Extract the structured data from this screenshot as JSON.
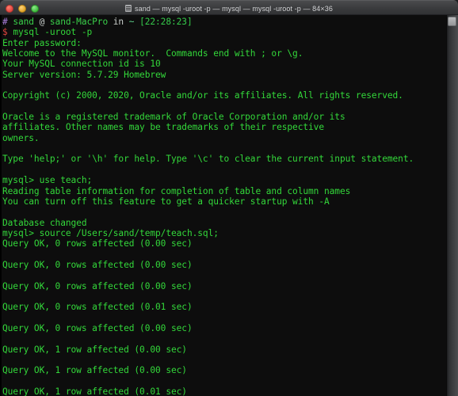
{
  "window": {
    "title": "sand — mysql -uroot -p — mysql — mysql -uroot -p — 84×36",
    "icon": "terminal-icon",
    "traffic_lights": {
      "close_label": "Close",
      "minimize_label": "Minimize",
      "maximize_label": "Maximize",
      "close_color": "#e0443e",
      "minimize_color": "#dea123",
      "maximize_color": "#3cb93a"
    },
    "size_label": "84×36",
    "columns": 84,
    "rows": 36
  },
  "theme": {
    "background": "#0d0d0d",
    "foreground": "#33d83a",
    "prompt_hash": "#a87ddb",
    "prompt_dollar": "#e0443e",
    "accent_white": "#c9cfcc",
    "titlebar_background": "#3a3b3d",
    "titlebar_text": "#d2d3d5"
  },
  "prompt": {
    "hash": "#",
    "user": "sand",
    "at": "@",
    "host": "sand-MacPro",
    "in": "in",
    "path": "~",
    "timestamp": "[22:28:23]",
    "dollar": "$",
    "command": "mysql -uroot -p"
  },
  "scrollbar": {
    "name": "vertical-scrollbar",
    "thumb_position_percent": 1
  },
  "terminal_lines": [
    {
      "type": "prompt_header"
    },
    {
      "type": "prompt_command"
    },
    {
      "type": "text",
      "text": "Enter password:"
    },
    {
      "type": "text",
      "text": "Welcome to the MySQL monitor.  Commands end with ; or \\g."
    },
    {
      "type": "text",
      "text": "Your MySQL connection id is 10"
    },
    {
      "type": "text",
      "text": "Server version: 5.7.29 Homebrew"
    },
    {
      "type": "blank",
      "text": ""
    },
    {
      "type": "text",
      "text": "Copyright (c) 2000, 2020, Oracle and/or its affiliates. All rights reserved."
    },
    {
      "type": "blank",
      "text": ""
    },
    {
      "type": "text",
      "text": "Oracle is a registered trademark of Oracle Corporation and/or its"
    },
    {
      "type": "text",
      "text": "affiliates. Other names may be trademarks of their respective"
    },
    {
      "type": "text",
      "text": "owners."
    },
    {
      "type": "blank",
      "text": ""
    },
    {
      "type": "text",
      "text": "Type 'help;' or '\\h' for help. Type '\\c' to clear the current input statement."
    },
    {
      "type": "blank",
      "text": ""
    },
    {
      "type": "text",
      "text": "mysql> use teach;"
    },
    {
      "type": "text",
      "text": "Reading table information for completion of table and column names"
    },
    {
      "type": "text",
      "text": "You can turn off this feature to get a quicker startup with -A"
    },
    {
      "type": "blank",
      "text": ""
    },
    {
      "type": "text",
      "text": "Database changed"
    },
    {
      "type": "text",
      "text": "mysql> source /Users/sand/temp/teach.sql;"
    },
    {
      "type": "text",
      "text": "Query OK, 0 rows affected (0.00 sec)"
    },
    {
      "type": "blank",
      "text": ""
    },
    {
      "type": "text",
      "text": "Query OK, 0 rows affected (0.00 sec)"
    },
    {
      "type": "blank",
      "text": ""
    },
    {
      "type": "text",
      "text": "Query OK, 0 rows affected (0.00 sec)"
    },
    {
      "type": "blank",
      "text": ""
    },
    {
      "type": "text",
      "text": "Query OK, 0 rows affected (0.01 sec)"
    },
    {
      "type": "blank",
      "text": ""
    },
    {
      "type": "text",
      "text": "Query OK, 0 rows affected (0.00 sec)"
    },
    {
      "type": "blank",
      "text": ""
    },
    {
      "type": "text",
      "text": "Query OK, 1 row affected (0.00 sec)"
    },
    {
      "type": "blank",
      "text": ""
    },
    {
      "type": "text",
      "text": "Query OK, 1 row affected (0.00 sec)"
    },
    {
      "type": "blank",
      "text": ""
    },
    {
      "type": "text",
      "text": "Query OK, 1 row affected (0.01 sec)"
    }
  ]
}
